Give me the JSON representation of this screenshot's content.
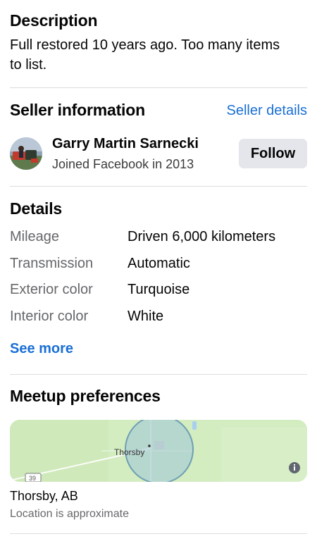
{
  "description": {
    "title": "Description",
    "text": "Full restored 10 years ago. Too many items to list."
  },
  "seller": {
    "title": "Seller information",
    "details_link": "Seller details",
    "name": "Garry Martin Sarnecki",
    "joined": "Joined Facebook in 2013",
    "follow_label": "Follow"
  },
  "details": {
    "title": "Details",
    "rows": [
      {
        "label": "Mileage",
        "value": "Driven 6,000 kilometers"
      },
      {
        "label": "Transmission",
        "value": "Automatic"
      },
      {
        "label": "Exterior color",
        "value": "Turquoise"
      },
      {
        "label": "Interior color",
        "value": "White"
      }
    ],
    "see_more": "See more"
  },
  "meetup": {
    "title": "Meetup preferences",
    "map_place_label": "Thorsby",
    "map_road_label": "39",
    "location": "Thorsby, AB",
    "location_note": "Location is approximate"
  },
  "colors": {
    "link": "#1a6fd6",
    "button_bg": "#e4e6eb",
    "secondary_text": "#65676b",
    "map_green": "#d3ecc0"
  }
}
